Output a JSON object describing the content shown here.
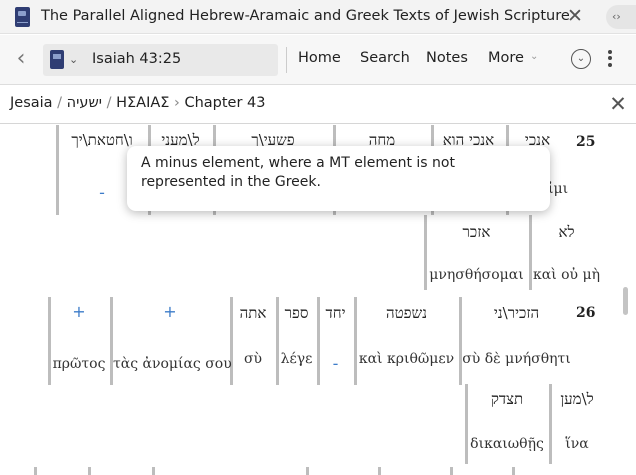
{
  "window": {
    "title": "The Parallel Aligned Hebrew-Aramaic and Greek Texts of Jewish Scripture",
    "close_glyph": "✕",
    "more_glyph": "‹›"
  },
  "toolbar": {
    "back_glyph": "‹",
    "chevron_glyph": "⌄",
    "location": "Isaiah 43:25",
    "home": "Home",
    "search": "Search",
    "notes": "Notes",
    "more": "More",
    "more_chevron": "⌄",
    "circle_chevron": "⌄"
  },
  "breadcrumb": {
    "book": "Jesaia",
    "hebrew": "ישעיה",
    "greek": "ΗΣΑΙΑΣ",
    "chapter": "Chapter 43",
    "slash": "/",
    "arrow": "›",
    "close_glyph": "✕"
  },
  "tooltip": {
    "text": "A minus element, where a MT element is not represented in the Greek."
  },
  "verse25": {
    "number": "25",
    "row1": [
      {
        "heb": "אנכי",
        "grk": "ἐγώ εἰμι"
      },
      {
        "heb": "אנכי הוא",
        "grk": ""
      },
      {
        "heb": "מחה",
        "grk": ""
      },
      {
        "heb": "פשעי\\ך",
        "grk": ""
      },
      {
        "heb": "ל\\מעני",
        "grk": ""
      },
      {
        "heb": "ו\\חטאת\\יך",
        "grk": "",
        "sign": "-"
      }
    ],
    "row2": [
      {
        "heb": "לא",
        "grk": "καὶ οὐ μὴ"
      },
      {
        "heb": "אזכר",
        "grk": "μνησθήσομαι"
      }
    ]
  },
  "verse26": {
    "number": "26",
    "row1": [
      {
        "heb": "הזכיר\\ני",
        "grk": "σὺ δὲ μνήσθητι"
      },
      {
        "heb": "נשפטה",
        "grk": "καὶ κριθῶμεν"
      },
      {
        "heb": "יחד",
        "grk": "",
        "sign": "-"
      },
      {
        "heb": "ספר",
        "grk": "λέγε"
      },
      {
        "heb": "אתה",
        "grk": "σὺ"
      },
      {
        "heb": "",
        "grk": "τὰς ἀνομίας σου",
        "sign": "+"
      },
      {
        "heb": "",
        "grk": "πρῶτος",
        "sign": "+"
      }
    ],
    "row2": [
      {
        "heb": "ל\\מען",
        "grk": "ἵνα"
      },
      {
        "heb": "תצדק",
        "grk": "δικαιωθῇς"
      }
    ]
  }
}
